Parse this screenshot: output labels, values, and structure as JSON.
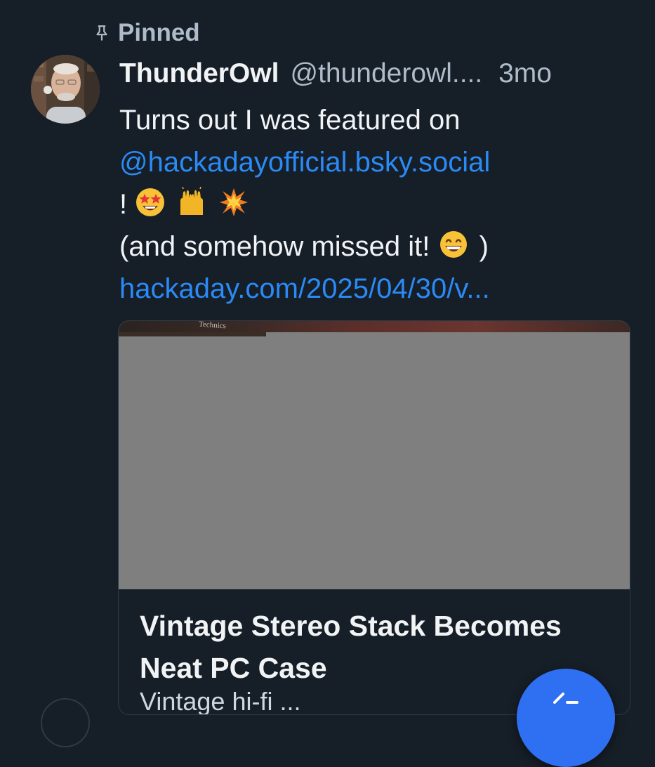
{
  "pinned": {
    "label": "Pinned",
    "icon": "pin-icon"
  },
  "post": {
    "author": {
      "display_name": "ThunderOwl",
      "handle": "@thunderowl....",
      "avatar_icon": "avatar-photo"
    },
    "time": "3mo",
    "text": {
      "line1": "Turns out I was featured on",
      "mention": "@hackadayofficial.bsky.social",
      "exclamation": "!",
      "emojis": [
        "star-struck-emoji",
        "raising-hands-emoji",
        "collision-emoji"
      ],
      "line4": "(and somehow missed it!",
      "line4_emoji": "grinning-face-emoji",
      "line4_end": ")",
      "link": "hackaday.com/2025/04/30/v..."
    },
    "card": {
      "image_brand": "Technics",
      "title": "Vintage Stereo Stack Becomes Neat PC Case",
      "description_partial": "Vintage hi-fi ..."
    }
  },
  "fab": {
    "icon": "compose-icon"
  },
  "colors": {
    "background": "#161e27",
    "text_primary": "#f1f3f5",
    "text_secondary": "#aebbc9",
    "link": "#2a8af6",
    "fab": "#2f6ff2",
    "card_border": "#2e3a47",
    "image_placeholder": "#7f7f7f"
  }
}
